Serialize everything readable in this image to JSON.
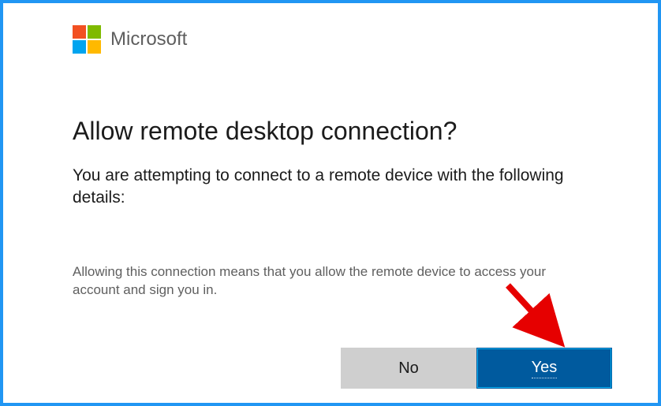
{
  "brand": {
    "name": "Microsoft"
  },
  "dialog": {
    "title": "Allow remote desktop connection?",
    "subtitle": "You are attempting to connect to a remote device with the following details:",
    "note": "Allowing this connection means that you allow the remote device to access your account and sign you in."
  },
  "buttons": {
    "no": "No",
    "yes": "Yes"
  }
}
